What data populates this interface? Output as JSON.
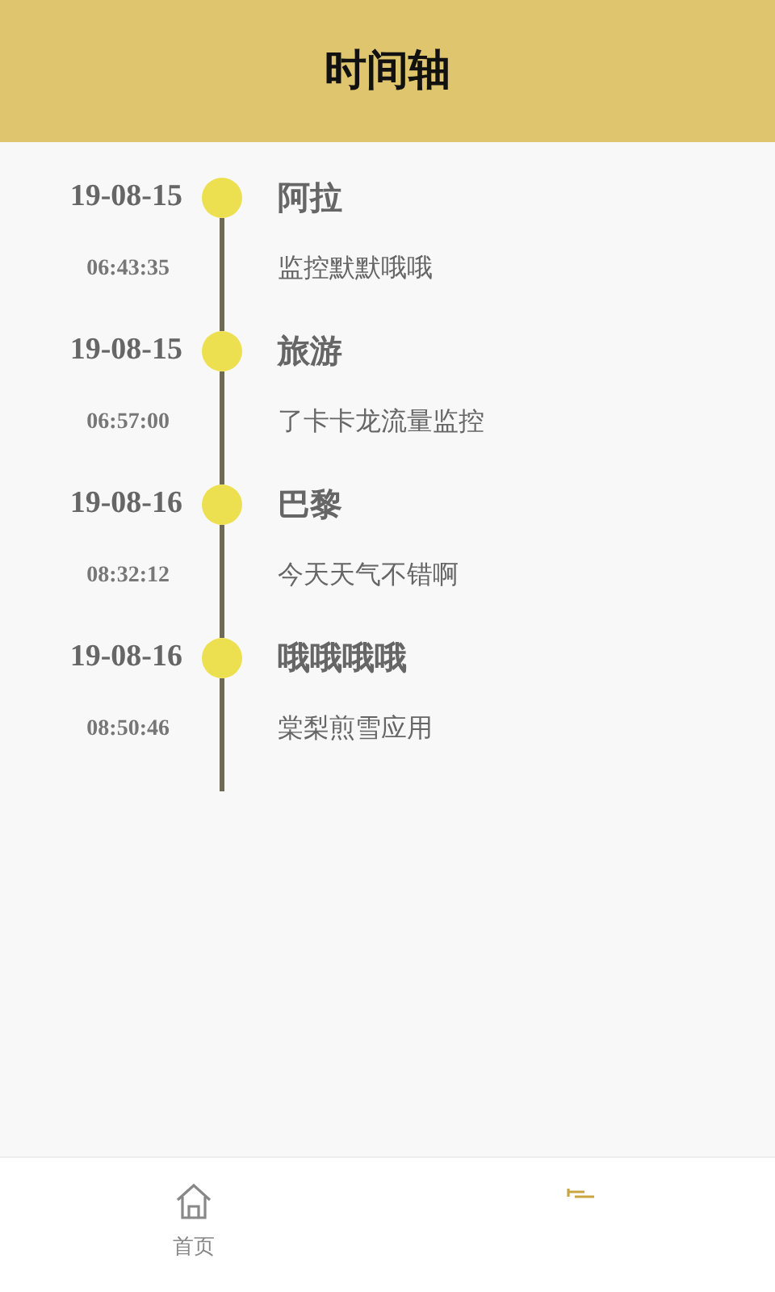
{
  "header": {
    "title": "时间轴"
  },
  "timeline": [
    {
      "date": "19-08-15",
      "time": "06:43:35",
      "title": "阿拉",
      "content": "监控默默哦哦"
    },
    {
      "date": "19-08-15",
      "time": "06:57:00",
      "title": "旅游",
      "content": "了卡卡龙流量监控"
    },
    {
      "date": "19-08-16",
      "time": "08:32:12",
      "title": "巴黎",
      "content": "今天天气不错啊"
    },
    {
      "date": "19-08-16",
      "time": "08:50:46",
      "title": "哦哦哦哦",
      "content": "棠梨煎雪应用"
    }
  ],
  "bottom_nav": [
    {
      "kind": "home",
      "label": "首页",
      "selected": false
    },
    {
      "kind": "timeline",
      "selected": true
    }
  ]
}
